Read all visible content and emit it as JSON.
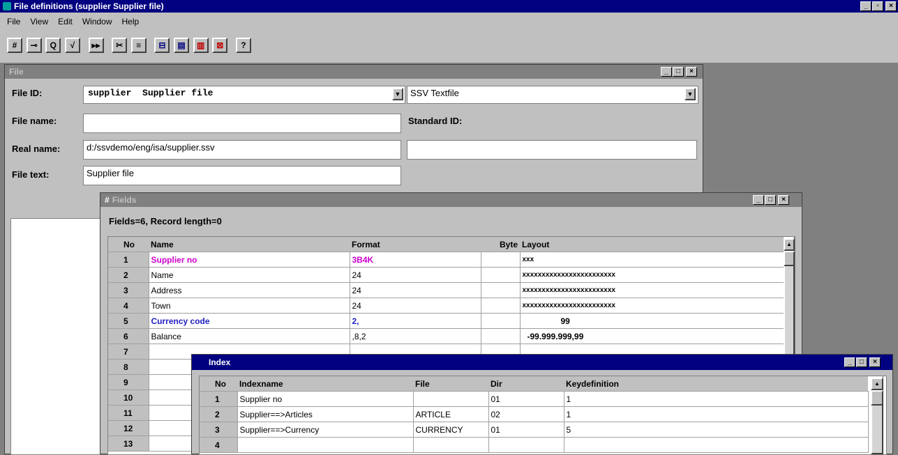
{
  "app": {
    "title": "File definitions (supplier Supplier file)",
    "menu": [
      "File",
      "View",
      "Edit",
      "Window",
      "Help"
    ],
    "toolbar": [
      "#",
      "⊸",
      "Q",
      "√",
      "▸▸",
      "✂",
      "≡",
      "⊟",
      "▤",
      "▥",
      "⊠",
      "?"
    ]
  },
  "file_window": {
    "title": "File",
    "file_id_label": "File ID:",
    "file_id_value": "supplier  Supplier file",
    "type_value": "SSV Textfile",
    "file_name_label": "File name:",
    "file_name_value": "",
    "standard_id_label": "Standard ID:",
    "real_name_label": "Real name:",
    "real_name_value": "d:/ssvdemo/eng/isa/supplier.ssv",
    "standard_id_value": "",
    "file_text_label": "File text:",
    "file_text_value": "Supplier file"
  },
  "fields_window": {
    "title": "Fields",
    "summary": "Fields=6, Record length=0",
    "columns": [
      "No",
      "Name",
      "Format",
      "Byte",
      "Layout"
    ],
    "rows": [
      {
        "no": "1",
        "name": "Supplier no",
        "format": "3B4K",
        "byte": "",
        "layout": "xxx",
        "color": "#cc00cc"
      },
      {
        "no": "2",
        "name": "Name",
        "format": "24",
        "byte": "",
        "layout": "xxxxxxxxxxxxxxxxxxxxxxxx",
        "color": "#000000"
      },
      {
        "no": "3",
        "name": "Address",
        "format": "24",
        "byte": "",
        "layout": "xxxxxxxxxxxxxxxxxxxxxxxx",
        "color": "#000000"
      },
      {
        "no": "4",
        "name": "Town",
        "format": "24",
        "byte": "",
        "layout": "xxxxxxxxxxxxxxxxxxxxxxxx",
        "color": "#000000"
      },
      {
        "no": "5",
        "name": "Currency code",
        "format": "2,",
        "byte": "",
        "layout": "99",
        "color": "#2020c0"
      },
      {
        "no": "6",
        "name": "Balance",
        "format": ",8,2",
        "byte": "",
        "layout": "-99.999.999,99",
        "color": "#000000"
      },
      {
        "no": "7",
        "name": "",
        "format": "",
        "byte": "",
        "layout": "",
        "color": "#000000"
      },
      {
        "no": "8",
        "name": "",
        "format": "",
        "byte": "",
        "layout": "",
        "color": "#000000"
      },
      {
        "no": "9",
        "name": "",
        "format": "",
        "byte": "",
        "layout": "",
        "color": "#000000"
      },
      {
        "no": "10",
        "name": "",
        "format": "",
        "byte": "",
        "layout": "",
        "color": "#000000"
      },
      {
        "no": "11",
        "name": "",
        "format": "",
        "byte": "",
        "layout": "",
        "color": "#000000"
      },
      {
        "no": "12",
        "name": "",
        "format": "",
        "byte": "",
        "layout": "",
        "color": "#000000"
      },
      {
        "no": "13",
        "name": "",
        "format": "",
        "byte": "",
        "layout": "",
        "color": "#000000"
      }
    ]
  },
  "index_window": {
    "title": "Index",
    "columns": [
      "No",
      "Indexname",
      "File",
      "Dir",
      "Keydefinition"
    ],
    "rows": [
      {
        "no": "1",
        "name": "Supplier no",
        "file": "",
        "dir": "01",
        "key": "1"
      },
      {
        "no": "2",
        "name": "Supplier==>Articles",
        "file": "ARTICLE",
        "dir": "02",
        "key": "1"
      },
      {
        "no": "3",
        "name": "Supplier==>Currency",
        "file": "CURRENCY",
        "dir": "01",
        "key": "5"
      },
      {
        "no": "4",
        "name": "",
        "file": "",
        "dir": "",
        "key": ""
      }
    ]
  }
}
